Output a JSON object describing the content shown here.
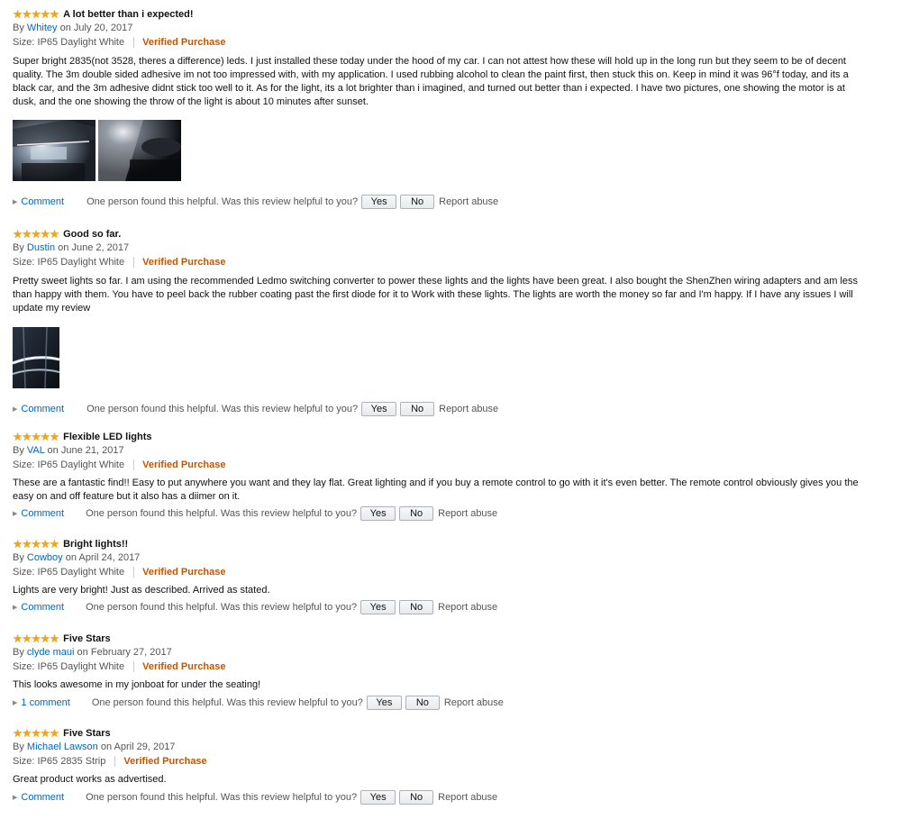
{
  "colors": {
    "star": "#f0a61a",
    "link": "#0066c0",
    "verified": "#c45500"
  },
  "icons": {
    "star": "star-icon",
    "expand": "triangle-right-icon"
  },
  "common": {
    "helpful_text": "One person found this helpful. Was this review helpful to you?",
    "yes_label": "Yes",
    "no_label": "No",
    "report_label": "Report abuse",
    "verified_label": "Verified Purchase",
    "by_label": "By",
    "on_label": "on"
  },
  "reviews": [
    {
      "rating": 5,
      "title": "A lot better than i expected!",
      "author": "Whitey",
      "date": "July 20, 2017",
      "size": "Size: IP65 Daylight White",
      "body": "Super bright 2835(not 3528, theres a difference) leds. I just installed these today under the hood of my car. I can not attest how these will hold up in the long run but they seem to be of decent quality. The 3m double sided adhesive im not too impressed with, with my application. I used rubbing alcohol to clean the paint first, then stuck this on. Keep in mind it was 96°f today, and its a black car, and the 3m adhesive didnt stick too well to it. As for the light, its a lot brighter than i imagined, and turned out better than i expected. I have two pictures, one showing the motor is at dusk, and the one showing the throw of the light is about 10 minutes after sunset.",
      "comment_label": "Comment"
    },
    {
      "rating": 5,
      "title": "Good so far.",
      "author": "Dustin",
      "date": "June 2, 2017",
      "size": "Size: IP65 Daylight White",
      "body": "Pretty sweet lights so far. I am using the recommended Ledmo switching converter to power these lights and the lights have been great. I also bought the ShenZhen wiring adapters and am less than happy with them. You have to peel back the rubber coating past the first diode for it to Work with these lights. The lights are worth the money so far and I'm happy. If I have any issues I will update my review",
      "comment_label": "Comment"
    },
    {
      "rating": 5,
      "title": "Flexible LED lights",
      "author": "VAL",
      "date": "June 21, 2017",
      "size": "Size: IP65 Daylight White",
      "body": "These are a fantastic find!! Easy to put anywhere you want and they lay flat. Great lighting and if you buy a remote control to go with it it's even better. The remote control obviously gives you the easy on and off feature but it also has a diimer on it.",
      "comment_label": "Comment"
    },
    {
      "rating": 5,
      "title": "Bright lights!!",
      "author": "Cowboy",
      "date": "April 24, 2017",
      "size": "Size: IP65 Daylight White",
      "body": "Lights are very bright! Just as described. Arrived as stated.",
      "comment_label": "Comment"
    },
    {
      "rating": 5,
      "title": "Five Stars",
      "author": "clyde maui",
      "date": "February 27, 2017",
      "size": "Size: IP65 Daylight White",
      "body": "This looks awesome in my jonboat for under the seating!",
      "comment_label": "1 comment"
    },
    {
      "rating": 5,
      "title": "Five Stars",
      "author": "Michael Lawson",
      "date": "April 29, 2017",
      "size": "Size: IP65 2835 Strip",
      "body": "Great product works as advertised.",
      "comment_label": "Comment"
    }
  ]
}
